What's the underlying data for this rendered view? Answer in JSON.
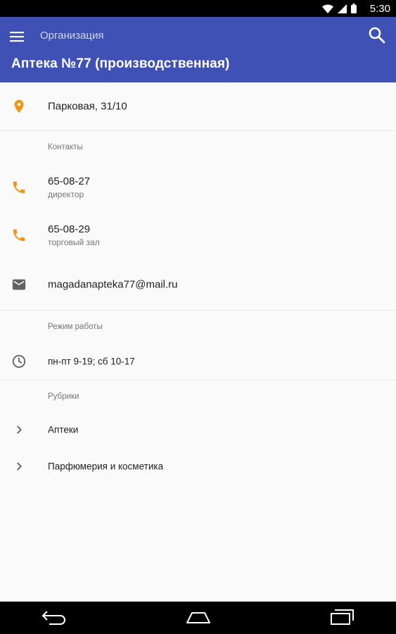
{
  "status_bar": {
    "time": "5:30"
  },
  "app_bar": {
    "section": "Организация",
    "title": "Аптека №77 (производственная)",
    "menu_icon": "hamburger-menu-icon",
    "search_icon": "search-icon"
  },
  "address": {
    "text": "Парковая, 31/10",
    "icon": "location-pin-icon"
  },
  "contacts": {
    "header": "Контакты",
    "phones": [
      {
        "number": "65-08-27",
        "label": "директор"
      },
      {
        "number": "65-08-29",
        "label": "торговый зал"
      }
    ],
    "email": "magadanapteka77@mail.ru"
  },
  "hours": {
    "header": "Режим работы",
    "text": "пн-пт 9-19; сб 10-17"
  },
  "rubrics": {
    "header": "Рубрики",
    "items": [
      "Аптеки",
      "Парфюмерия и косметика"
    ]
  },
  "colors": {
    "primary": "#3f51b5",
    "accent": "#f29312",
    "background": "#fafafa"
  }
}
